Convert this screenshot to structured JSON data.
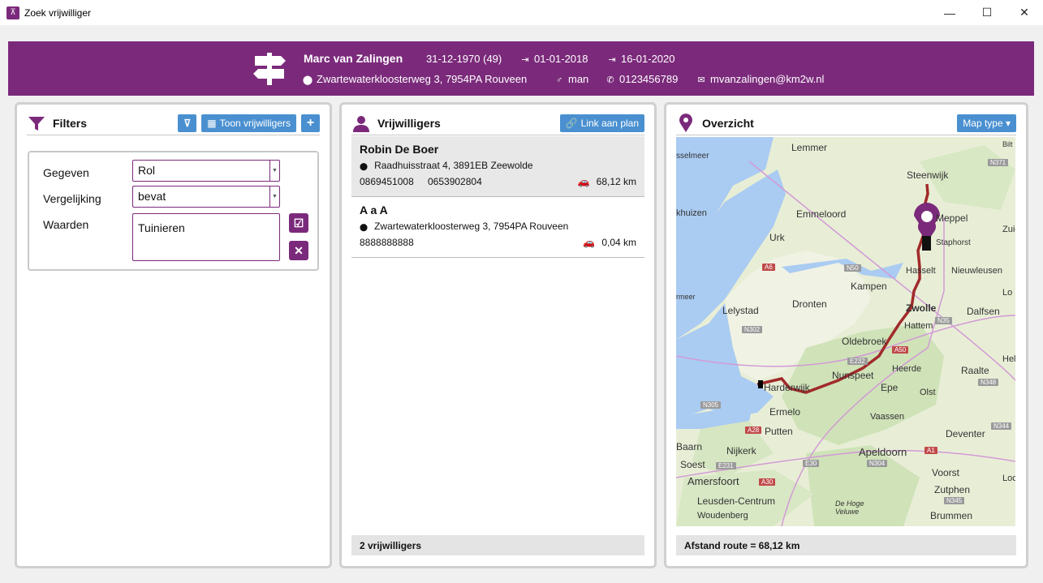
{
  "window": {
    "title": "Zoek vrijwilliger",
    "minimize": "—",
    "maximize": "☐",
    "close": "✕"
  },
  "header": {
    "name": "Marc van Zalingen",
    "dob": "31-12-1970 (49)",
    "start": "01-01-2018",
    "end": "16-01-2020",
    "address": "Zwartewaterkloosterweg 3, 7954PA Rouveen",
    "gender": "man",
    "phone": "0123456789",
    "email": "mvanzalingen@km2w.nl",
    "brand_color": "#7b2a7b"
  },
  "filters": {
    "title": "Filters",
    "show_button": "Toon vrijwilligers",
    "rows": [
      {
        "label": "Gegeven",
        "value": "Rol"
      },
      {
        "label": "Vergelijking",
        "value": "bevat"
      },
      {
        "label": "Waarden",
        "value": "Tuinieren"
      }
    ]
  },
  "volunteers": {
    "title": "Vrijwilligers",
    "link_button": "Link aan plan",
    "items": [
      {
        "name": "Robin De Boer",
        "address": "Raadhuisstraat 4, 3891EB Zeewolde",
        "phone1": "0869451008",
        "phone2": "0653902804",
        "distance": "68,12 km",
        "selected": true
      },
      {
        "name": "A a A",
        "address": "Zwartewaterkloosterweg 3, 7954PA Rouveen",
        "phone1": "8888888888",
        "phone2": "",
        "distance": "0,04 km",
        "selected": false
      }
    ],
    "footer": "2 vrijwilligers"
  },
  "overview": {
    "title": "Overzicht",
    "map_type_button": "Map type ▾",
    "footer": "Afstand route = 68,12 km",
    "places": [
      "Lemmer",
      "Steenwijk",
      "Emmeloord",
      "Meppel",
      "Staphorst",
      "Urk",
      "Hasselt",
      "Nieuwleusen",
      "Kampen",
      "Zwolle",
      "Dalfsen",
      "Lelystad",
      "Dronten",
      "Hattem",
      "Oldebroek",
      "Heerde",
      "Raalte",
      "Nunspeet",
      "Epe",
      "Olst",
      "Harderwijk",
      "Ermelo",
      "Vaassen",
      "Putten",
      "Deventer",
      "Nijkerk",
      "Baarn",
      "Apeldoorn",
      "Soest",
      "Voorst",
      "Amersfoort",
      "Zutphen",
      "Leusden-Centrum",
      "Woudenberg",
      "Brummen",
      "De Hoge Veluwe",
      "sselmeer",
      "khuizen",
      "rmeer",
      "Zuid",
      "Hel",
      "Lo",
      "Loc",
      "Bilt"
    ],
    "roads": [
      "N371",
      "A6",
      "N50",
      "N35",
      "N302",
      "A50",
      "E232",
      "N348",
      "N305",
      "A28",
      "N344",
      "E231",
      "E30",
      "N304",
      "A1",
      "A30",
      "N345"
    ]
  }
}
